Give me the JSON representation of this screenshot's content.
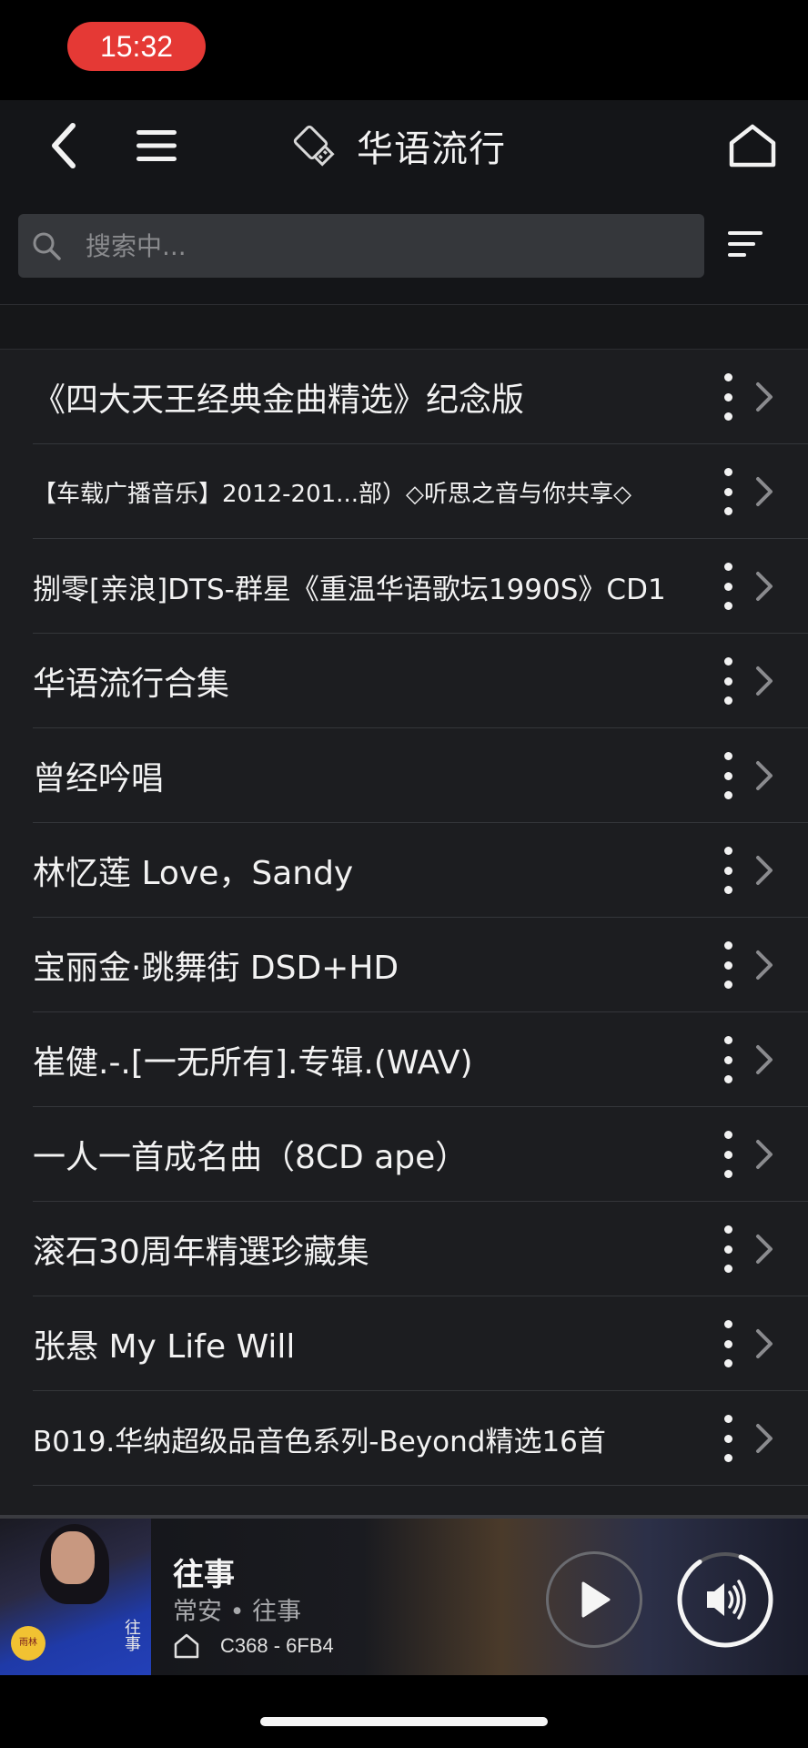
{
  "status_bar": {
    "time": "15:32"
  },
  "nav": {
    "title": "华语流行",
    "icons": [
      "back-icon",
      "menu-icon",
      "usb-icon",
      "home-icon"
    ]
  },
  "search": {
    "placeholder": "搜索中..."
  },
  "list": {
    "items": [
      {
        "label": "《四大天王经典金曲精选》纪念版",
        "size": "large"
      },
      {
        "label": "【车载广播音乐】2012-201...部）◇听思之音与你共享◇",
        "size": "small"
      },
      {
        "label": "捌零[亲浪]DTS-群星《重温华语歌坛1990S》CD1",
        "size": "med"
      },
      {
        "label": "华语流行合集",
        "size": "large"
      },
      {
        "label": "曾经吟唱",
        "size": "large"
      },
      {
        "label": "林忆莲 Love，Sandy",
        "size": "large"
      },
      {
        "label": "宝丽金·跳舞街 DSD+HD",
        "size": "large"
      },
      {
        "label": "崔健.-.[一无所有].专辑.(WAV)",
        "size": "large"
      },
      {
        "label": "一人一首成名曲（8CD ape）",
        "size": "large"
      },
      {
        "label": "滚石30周年精選珍藏集",
        "size": "large"
      },
      {
        "label": "张悬 My Life Will",
        "size": "large"
      },
      {
        "label": "B019.华纳超级品音色系列-Beyond精选16首",
        "size": "med"
      }
    ]
  },
  "player": {
    "title": "往事",
    "subtitle": "常安 • 往事",
    "device": "C368 - 6FB4",
    "album_art_text": "往事",
    "album_art_small": "常安",
    "album_badge": "雨林",
    "volume_level": 0.9
  },
  "colors": {
    "time_pill": "#e53935",
    "background": "#1c1d20",
    "nav_background": "#141518",
    "search_box": "#35373b"
  }
}
